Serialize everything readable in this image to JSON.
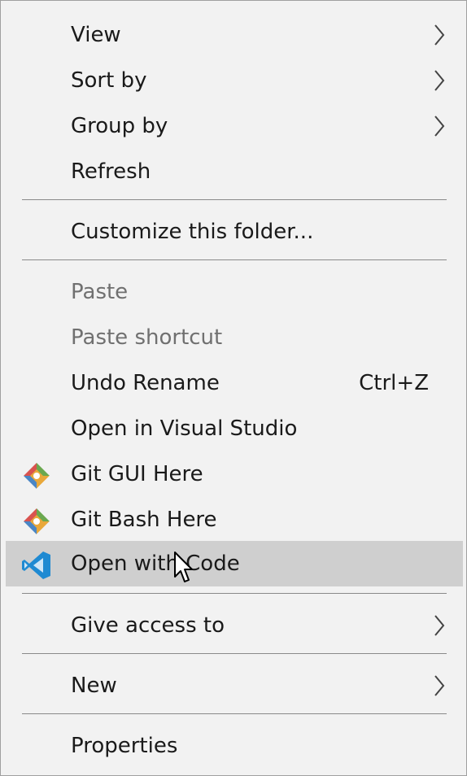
{
  "menu": {
    "items": [
      {
        "label": "View",
        "submenu": true
      },
      {
        "label": "Sort by",
        "submenu": true
      },
      {
        "label": "Group by",
        "submenu": true
      },
      {
        "label": "Refresh"
      },
      {
        "label": "Customize this folder..."
      },
      {
        "label": "Paste",
        "disabled": true
      },
      {
        "label": "Paste shortcut",
        "disabled": true
      },
      {
        "label": "Undo Rename",
        "shortcut": "Ctrl+Z"
      },
      {
        "label": "Open in Visual Studio"
      },
      {
        "label": "Git GUI Here",
        "icon": "git-icon"
      },
      {
        "label": "Git Bash Here",
        "icon": "git-icon"
      },
      {
        "label": "Open with Code",
        "icon": "vscode-icon",
        "highlighted": true
      },
      {
        "label": "Give access to",
        "submenu": true
      },
      {
        "label": "New",
        "submenu": true
      },
      {
        "label": "Properties"
      }
    ]
  },
  "colors": {
    "menu_background": "#f2f2f2",
    "highlight_background": "#cfcfcf",
    "disabled_text": "#707070",
    "vscode_blue": "#1f8ad2"
  }
}
